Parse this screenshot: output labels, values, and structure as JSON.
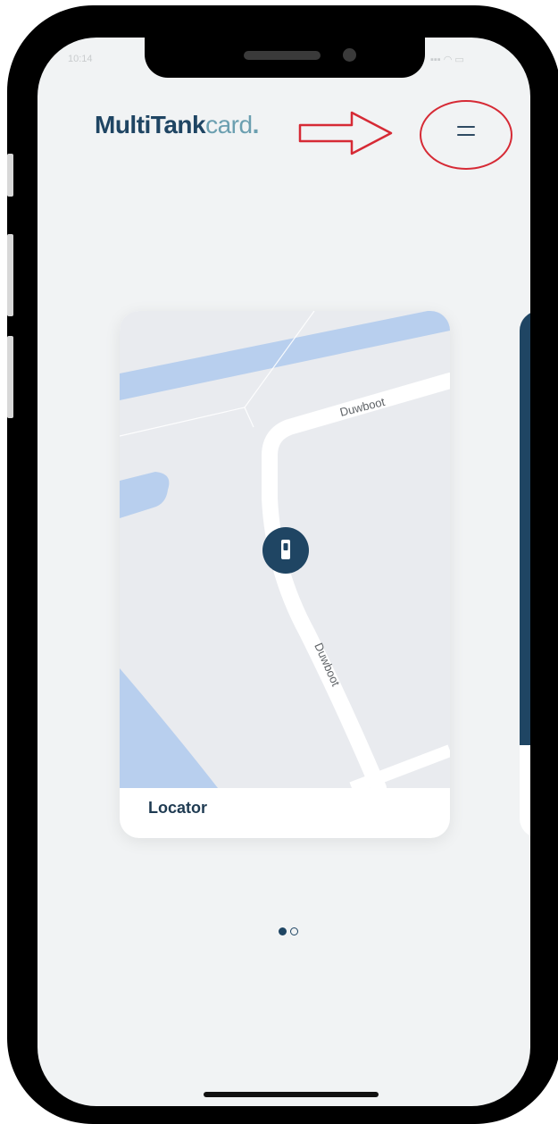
{
  "status_bar": {
    "time": "10:14",
    "signal": "▪▪▪ ◠ ▭"
  },
  "header": {
    "logo_part1": "MultiTank",
    "logo_part2": "card",
    "logo_dot": "."
  },
  "colors": {
    "brand_dark": "#1f4563",
    "brand_light": "#6b9fb0",
    "annotation_red": "#d62a35"
  },
  "menu": {
    "icon": "hamburger-menu-icon"
  },
  "cards": [
    {
      "label": "Locator",
      "map": {
        "streets": [
          "Duwboot",
          "Duwboot"
        ],
        "marker_icon": "fuel-pump-icon"
      }
    },
    {
      "label": ""
    }
  ],
  "pagination": {
    "count": 2,
    "active": 0
  }
}
